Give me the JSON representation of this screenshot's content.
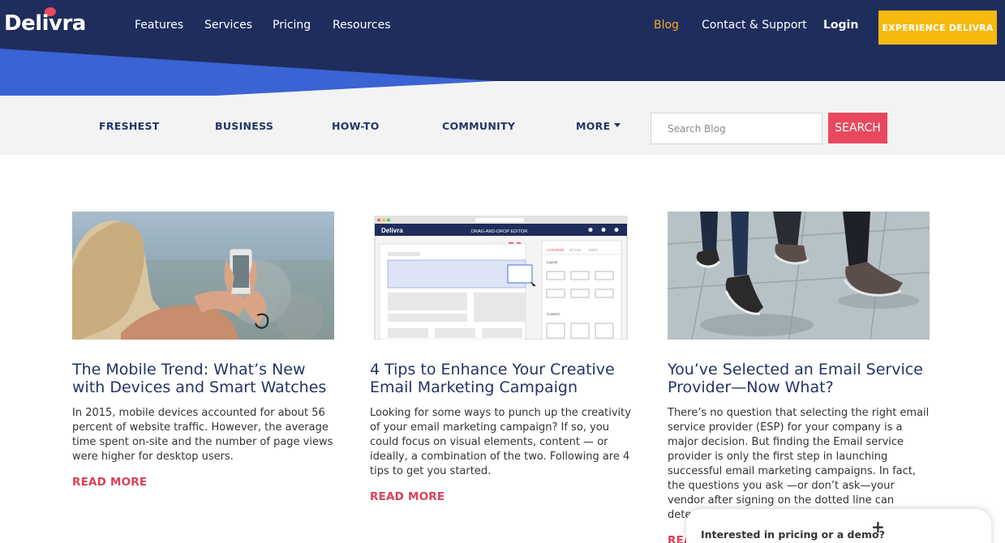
{
  "brand": {
    "logo_text": "Delivra"
  },
  "nav": {
    "links": [
      "Features",
      "Services",
      "Pricing",
      "Resources"
    ],
    "blog": "Blog",
    "contact": "Contact & Support",
    "login": "Login",
    "cta": "EXPERIENCE DELIVRA"
  },
  "categories": {
    "items": [
      "FRESHEST",
      "BUSINESS",
      "HOW-TO",
      "COMMUNITY"
    ],
    "more": "MORE"
  },
  "search": {
    "placeholder": "Search Blog",
    "button": "SEARCH"
  },
  "posts": [
    {
      "title": "The Mobile Trend: What’s New with Devices and Smart Watches",
      "excerpt": "In 2015, mobile devices accounted for about 56 percent of website traffic. However, the average time spent on-site and the number of page views were higher for desktop users.",
      "read_more": "READ MORE"
    },
    {
      "title": "4 Tips to Enhance Your Creative Email Marketing Campaign",
      "excerpt": "Looking for some ways to punch up the creativity of your email marketing campaign? If so, you could focus on visual elements, content — or ideally, a combination of the two. Following are 4 tips to get you started.",
      "read_more": "READ MORE",
      "thumb": {
        "brand": "Delivra",
        "editor_title": "DRAG-AND-DROP EDITOR",
        "tabs": [
          "CONTENT",
          "STYLE",
          "INFO"
        ],
        "layout_label": "Layout",
        "content_label": "Content"
      }
    },
    {
      "title": "You’ve Selected an Email Service Provider—Now What?",
      "excerpt": "There’s no question that selecting the right email service provider (ESP) for your company is a major decision. But finding the Email service provider is only the first step in launching successful email marketing campaigns. In fact, the questions you ask —or don’t ask—your vendor after signing on the dotted line can determine how successful your […]",
      "read_more": "READ MORE"
    }
  ],
  "chat": {
    "text": "Interested in pricing or a demo?",
    "plus": "+"
  },
  "colors": {
    "navy": "#1f2d5c",
    "blue": "#3a63d3",
    "accent_yellow": "#f5b90f",
    "blog_orange": "#f5a623",
    "red": "#e8485f",
    "title_navy": "#233466"
  }
}
